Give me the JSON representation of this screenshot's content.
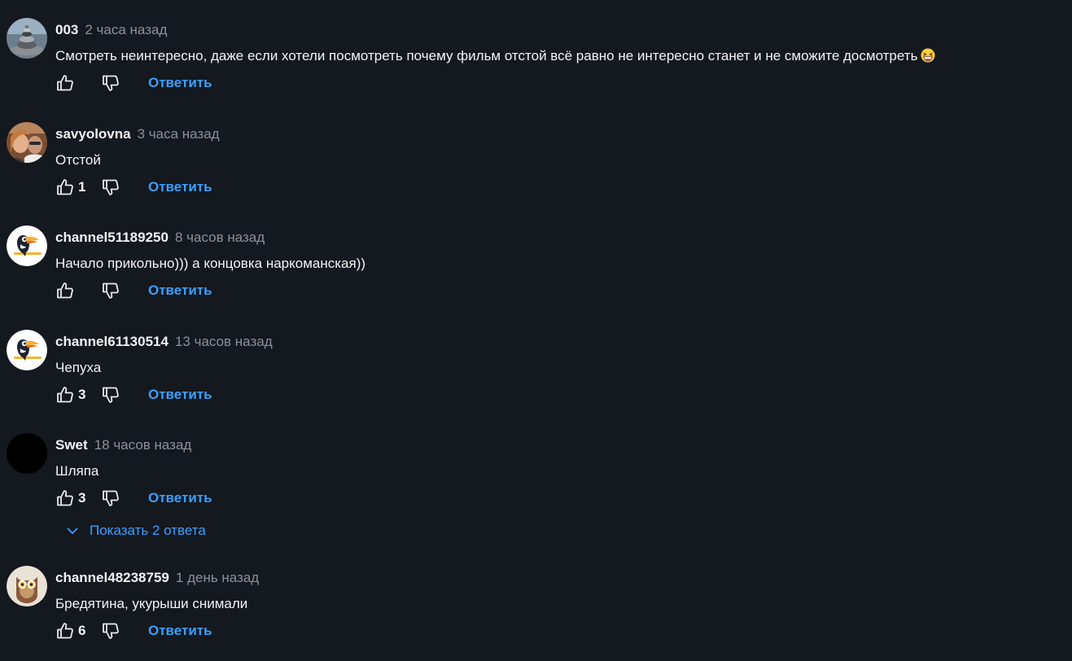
{
  "comments": [
    {
      "author": "003",
      "time": "2 часа назад",
      "text": "Смотреть неинтересно, даже если хотели посмотреть почему фильм отстой всё равно не интересно станет и не сможите досмотреть",
      "emoji": "grinning-squinting-face",
      "likes": "",
      "reply_label": "Ответить",
      "avatar": "sea-stones-photo"
    },
    {
      "author": "savyolovna",
      "time": "3 часа назад",
      "text": "Отстой",
      "likes": "1",
      "reply_label": "Ответить",
      "avatar": "couple-photo"
    },
    {
      "author": "channel51189250",
      "time": "8 часов назад",
      "text": "Начало прикольно))) а концовка наркоманская))",
      "likes": "",
      "reply_label": "Ответить",
      "avatar": "toucan-icon"
    },
    {
      "author": "channel61130514",
      "time": "13 часов назад",
      "text": "Чепуха",
      "likes": "3",
      "reply_label": "Ответить",
      "avatar": "toucan-icon"
    },
    {
      "author": "Swet",
      "time": "18 часов назад",
      "text": "Шляпа",
      "likes": "3",
      "reply_label": "Ответить",
      "avatar": "black-circle"
    },
    {
      "author": "channel48238759",
      "time": "1 день назад",
      "text": "Бредятина, укурыши снимали",
      "likes": "6",
      "reply_label": "Ответить",
      "avatar": "owl-icon"
    }
  ],
  "show_replies_label": "Показать 2 ответа",
  "colors": {
    "background": "#14181f",
    "link": "#3aa0ff",
    "muted": "#8b919b",
    "text": "#f1f3f5"
  }
}
